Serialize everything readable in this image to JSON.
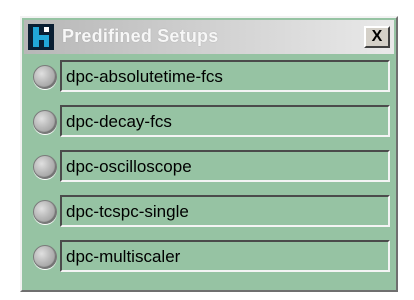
{
  "window": {
    "title": "Predifined Setups",
    "close_label": "X",
    "icon": "app-logo-icon"
  },
  "setups": [
    {
      "label": "dpc-absolutetime-fcs",
      "selected": false
    },
    {
      "label": "dpc-decay-fcs",
      "selected": false
    },
    {
      "label": "dpc-oscilloscope",
      "selected": false
    },
    {
      "label": "dpc-tcspc-single",
      "selected": false
    },
    {
      "label": "dpc-multiscaler",
      "selected": false
    }
  ],
  "colors": {
    "panel_background": "#96c3a3",
    "title_text": "#f7f7f7",
    "logo_dark": "#0a1f33",
    "logo_accent": "#22a7d8"
  }
}
